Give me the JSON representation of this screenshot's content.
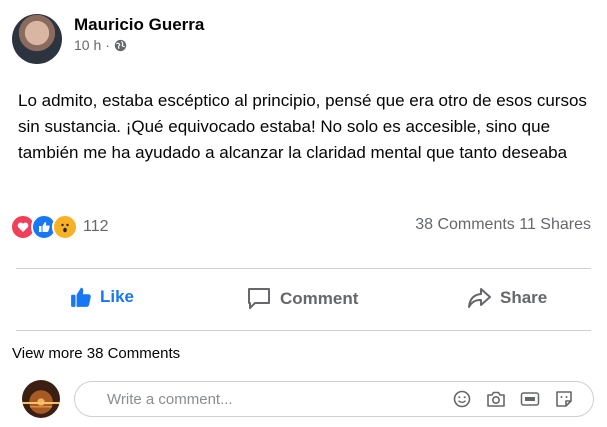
{
  "post": {
    "author": "Mauricio Guerra",
    "time": "10 h",
    "separator": "·",
    "audience_icon": "globe-icon",
    "text": "Lo admito, estaba escéptico al principio, pensé que era otro de esos cursos sin sustancia. ¡Qué equivocado estaba! No solo es accesible, sino que también me ha ayudado a alcanzar la claridad mental que tanto deseaba"
  },
  "reactions": {
    "icons": [
      "love-reaction-icon",
      "like-reaction-icon",
      "wow-reaction-icon"
    ],
    "count": "112",
    "comments": "38 Comments",
    "shares": "11 Shares"
  },
  "actions": {
    "like": "Like",
    "comment": "Comment",
    "share": "Share"
  },
  "comments": {
    "view_more": "View more 38 Comments",
    "placeholder": "Write a comment...",
    "icons": [
      "emoji-icon",
      "camera-icon",
      "gif-icon",
      "sticker-icon"
    ]
  },
  "colors": {
    "accent": "#1877f2",
    "secondary_text": "#65676b",
    "divider": "#ced0d4"
  }
}
